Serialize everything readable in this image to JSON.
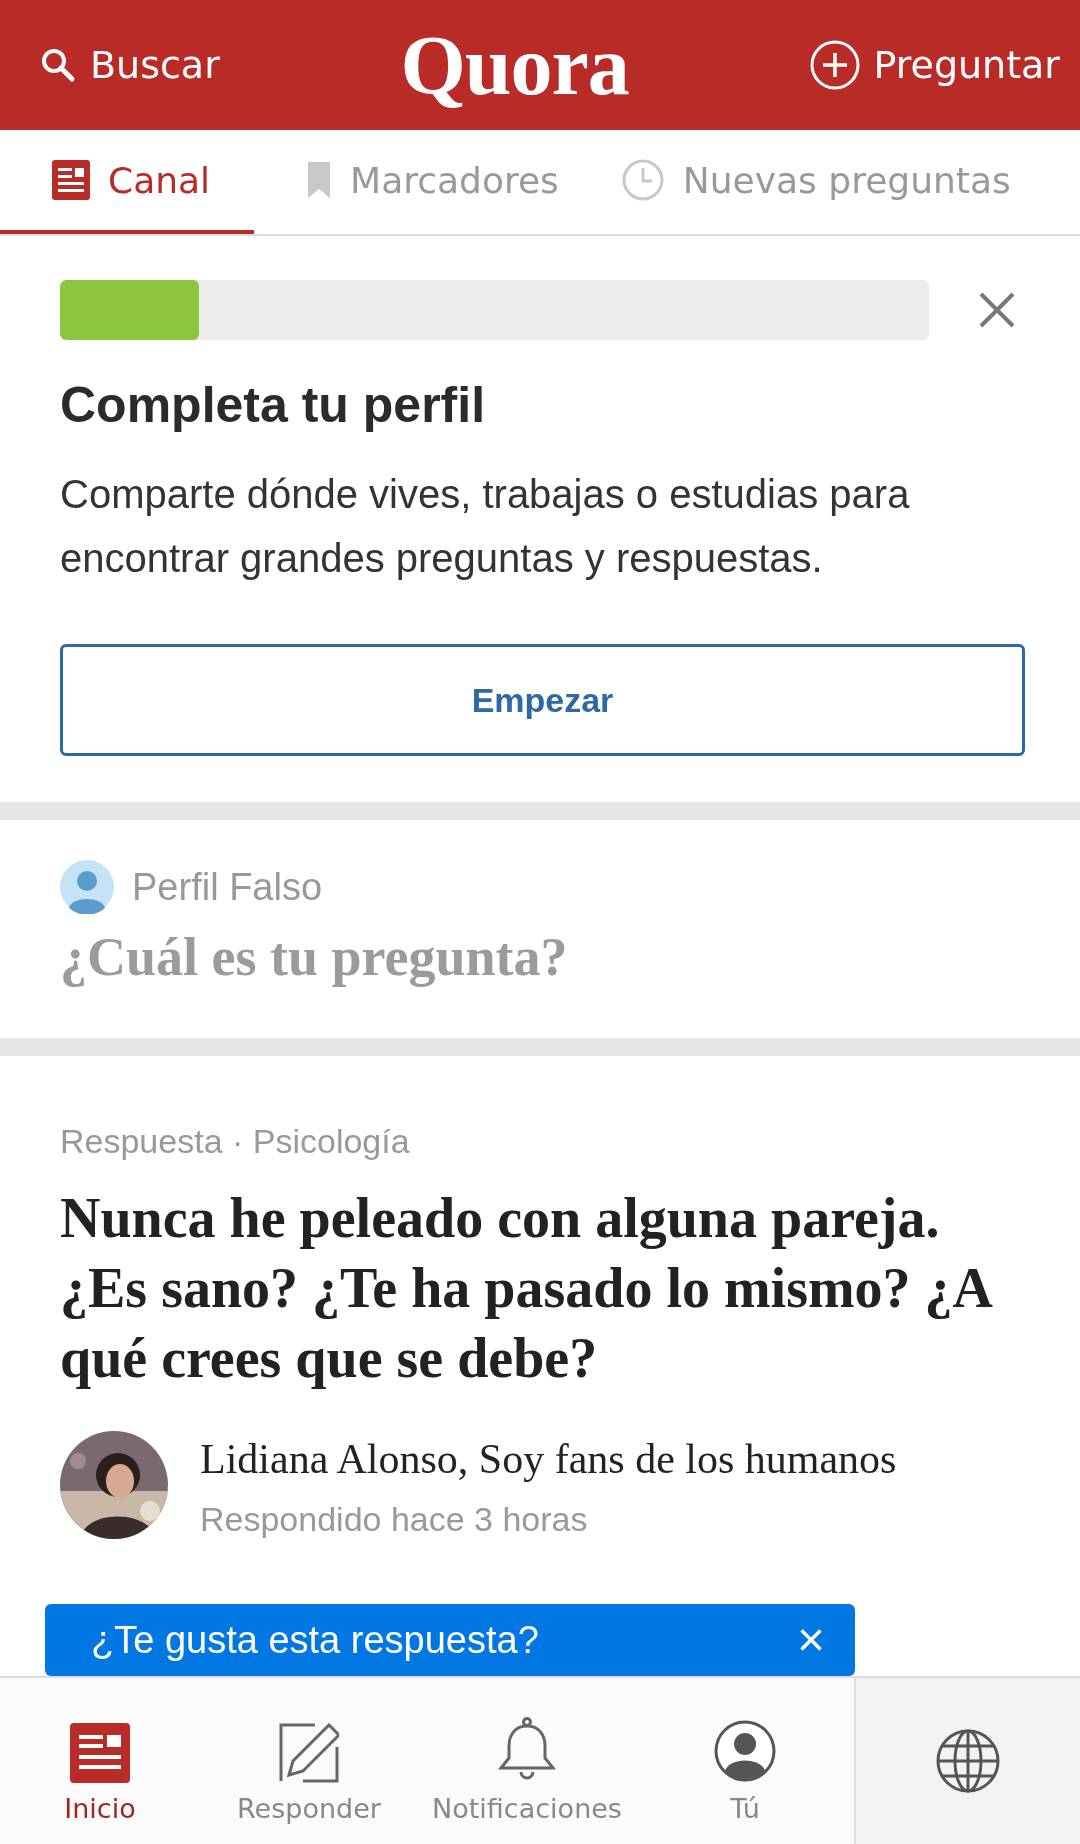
{
  "header": {
    "search": "Buscar",
    "logo": "Quora",
    "ask": "Preguntar"
  },
  "tabs": [
    {
      "label": "Canal",
      "selected": true
    },
    {
      "label": "Marcadores",
      "selected": false
    },
    {
      "label": "Nuevas preguntas",
      "selected": false
    }
  ],
  "profile_card": {
    "level": 0.16,
    "title": "Completa tu perfil",
    "text": "Comparte dónde vives, trabajas o estudias para encontrar grandes preguntas y respuestas.",
    "button": "Empezar"
  },
  "ask_box": {
    "user": "Perfil Falso",
    "placeholder": "¿Cuál es tu pregunta?"
  },
  "answer": {
    "meta": "Respuesta · Psicología",
    "question": "Nunca he peleado con alguna pareja. ¿Es sano? ¿Te ha pasado lo mismo? ¿A qué crees que se debe?",
    "author": "Lidiana Alonso, Soy fans de los humanos",
    "time": "Respondido hace 3 horas"
  },
  "toast": {
    "text": "¿Te gusta esta respuesta?",
    "close": "×"
  },
  "bottom_nav": [
    {
      "label": "Inicio",
      "selected": true
    },
    {
      "label": "Responder",
      "selected": false
    },
    {
      "label": "Notificaciones",
      "selected": false
    },
    {
      "label": "Tú",
      "selected": false
    }
  ]
}
